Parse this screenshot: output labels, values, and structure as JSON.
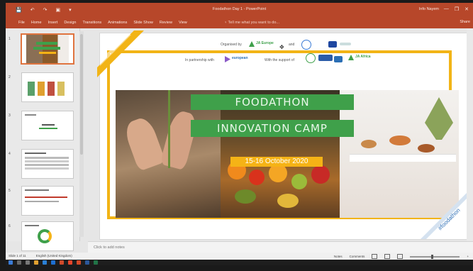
{
  "window": {
    "title": "Foodathon Day 1 - PowerPoint",
    "sign_in": "Info Nayem",
    "minimize_glyph": "—",
    "maximize_glyph": "❐",
    "close_glyph": "✕"
  },
  "quick_access": [
    "💾",
    "↶",
    "↷",
    "▣",
    "▾"
  ],
  "ribbon": {
    "tabs": [
      "File",
      "Home",
      "Insert",
      "Design",
      "Transitions",
      "Animations",
      "Slide Show",
      "Review",
      "View"
    ],
    "tell_me": "♀ Tell me what you want to do...",
    "share": "Share"
  },
  "thumbnails": [
    {
      "num": "1",
      "active": true
    },
    {
      "num": "2",
      "active": false
    },
    {
      "num": "3",
      "active": false
    },
    {
      "num": "4",
      "active": false
    },
    {
      "num": "5",
      "active": false
    },
    {
      "num": "6",
      "active": false
    }
  ],
  "slide": {
    "organised_by": "Organised by",
    "ja_europe": "JA Europe",
    "and": "and",
    "in_partnership": "In partnership with",
    "european": "european",
    "support": "With the support of",
    "ja_africa": "JA Africa",
    "headline1": "FOODATHON",
    "headline2": "INNOVATION CAMP",
    "date": "15-16 October 2020",
    "hashtag": "#foodathon"
  },
  "notes_placeholder": "Click to add notes",
  "status": {
    "slide_info": "Slide 1 of 11",
    "language": "English (United Kingdom)",
    "notes": "Notes",
    "comments": "Comments",
    "zoom": "+ "
  },
  "colors": {
    "accent": "#b7472a",
    "frame": "#f2b416",
    "headline_green": "#3fa04a"
  }
}
